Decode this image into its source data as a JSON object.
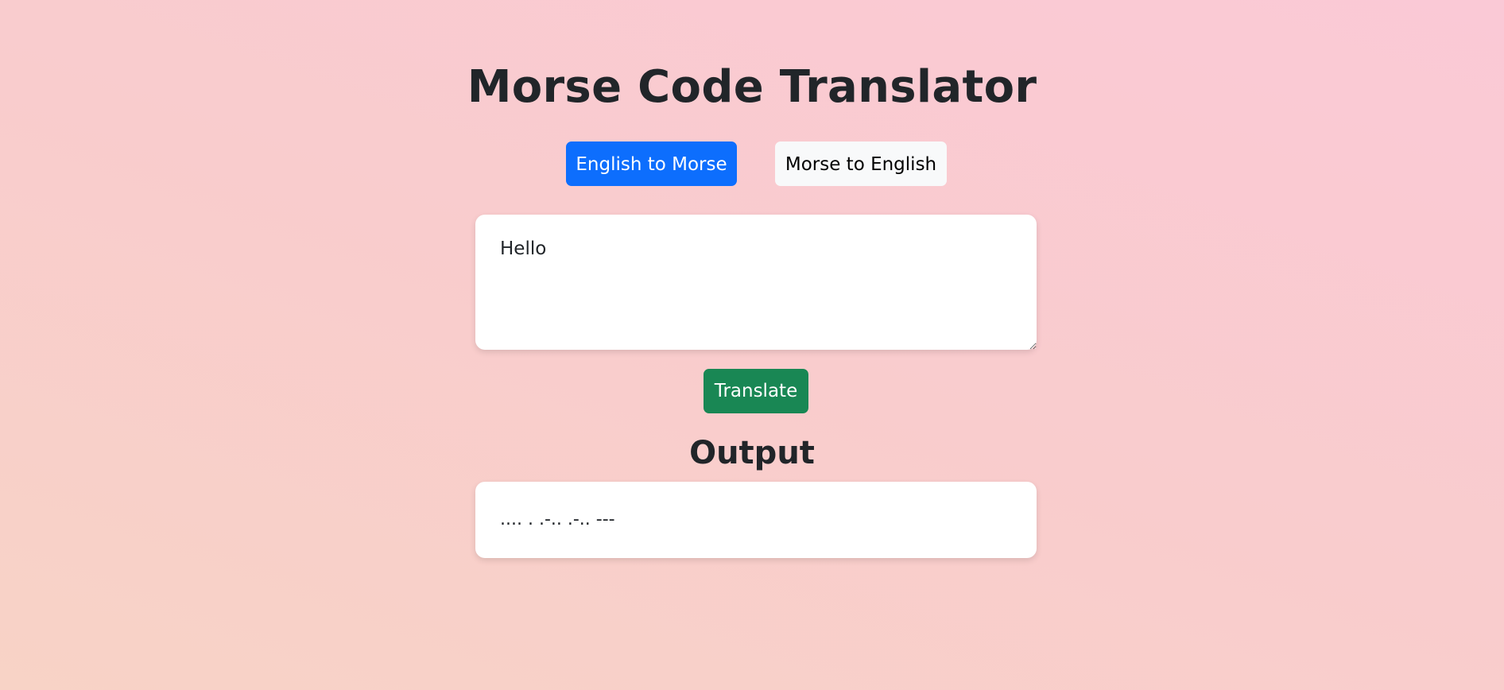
{
  "app": {
    "title": "Morse Code Translator"
  },
  "mode_toggle": {
    "english_to_morse_label": "English to Morse",
    "morse_to_english_label": "Morse to English",
    "active": "english_to_morse"
  },
  "input": {
    "value": "Hello"
  },
  "actions": {
    "translate_label": "Translate"
  },
  "output": {
    "heading": "Output",
    "value": ".... . .-.. .-.. ---"
  },
  "colors": {
    "primary": "#0d6efd",
    "success": "#198754",
    "light": "#f8f9fa",
    "text": "#212529"
  }
}
